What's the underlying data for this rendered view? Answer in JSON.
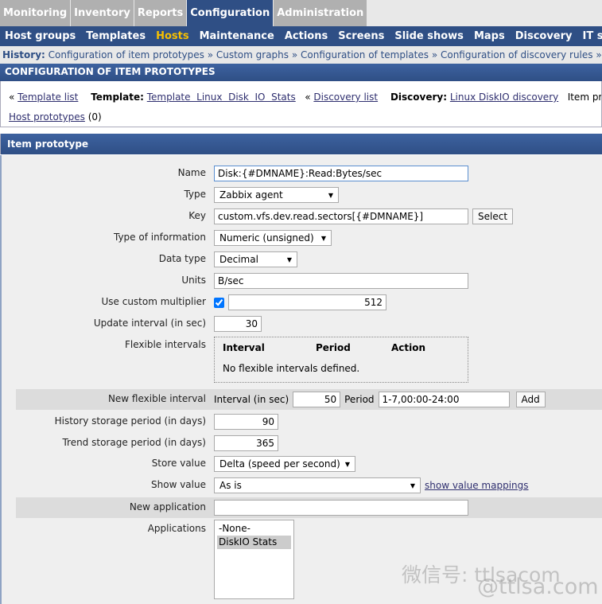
{
  "topnav": [
    "Monitoring",
    "Inventory",
    "Reports",
    "Configuration",
    "Administration"
  ],
  "subnav": [
    "Host groups",
    "Templates",
    "Hosts",
    "Maintenance",
    "Actions",
    "Screens",
    "Slide shows",
    "Maps",
    "Discovery",
    "IT services"
  ],
  "history": {
    "label": "History:",
    "items": "Configuration of item prototypes » Custom graphs » Configuration of templates » Configuration of discovery rules »"
  },
  "page_title": "CONFIGURATION OF ITEM PROTOTYPES",
  "crumbs": {
    "template_list": "Template list",
    "template_label": "Template:",
    "template": "Template  Linux  Disk  IO  Stats",
    "discovery_list": "Discovery list",
    "discovery_label": "Discovery:",
    "discovery": "Linux DiskIO discovery",
    "item_prototypes": "Item prototypes",
    "host_prototypes": "Host prototypes",
    "host_count": "(0)",
    "laquo": "«"
  },
  "section": "Item prototype",
  "form": {
    "name_label": "Name",
    "name": "Disk:{#DMNAME}:Read:Bytes/sec",
    "type_label": "Type",
    "type": "Zabbix agent",
    "key_label": "Key",
    "key": "custom.vfs.dev.read.sectors[{#DMNAME}]",
    "select": "Select",
    "info_label": "Type of information",
    "info": "Numeric (unsigned)",
    "datatype_label": "Data type",
    "datatype": "Decimal",
    "units_label": "Units",
    "units": "B/sec",
    "mult_label": "Use custom multiplier",
    "mult_checked": true,
    "mult": "512",
    "interval_label": "Update interval (in sec)",
    "interval": "30",
    "flex_label": "Flexible intervals",
    "flex_cols": [
      "Interval",
      "Period",
      "Action"
    ],
    "flex_empty": "No flexible intervals defined.",
    "newflex_label": "New flexible interval",
    "newflex_interval_label": "Interval (in sec)",
    "newflex_interval": "50",
    "newflex_period_label": "Period",
    "newflex_period": "1-7,00:00-24:00",
    "add": "Add",
    "history_label": "History storage period (in days)",
    "history": "90",
    "trend_label": "Trend storage period (in days)",
    "trend": "365",
    "store_label": "Store value",
    "store": "Delta (speed per second)",
    "show_label": "Show value",
    "show": "As is",
    "mappings": "show value mappings",
    "newapp_label": "New application",
    "newapp": "",
    "apps_label": "Applications",
    "apps": [
      "-None-",
      "DiskIO Stats"
    ]
  },
  "watermark": [
    "微信号: ttlsacom",
    "@ttlsa.com"
  ]
}
